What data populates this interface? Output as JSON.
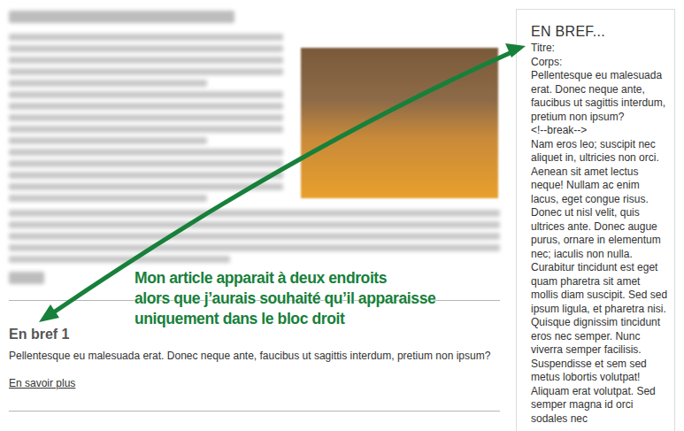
{
  "annotation": {
    "lines": [
      "Mon article apparait à deux endroits",
      "alors que j’aurais souhaité qu’il apparaisse",
      "uniquement dans le bloc droit"
    ]
  },
  "main": {
    "teaser": {
      "title": "En bref 1",
      "summary": "Pellentesque eu malesuada erat. Donec neque ante, faucibus ut sagittis interdum, pretium non ipsum?",
      "link": "En savoir plus"
    }
  },
  "sidebar": {
    "heading": "EN BREF...",
    "lines": [
      "Titre:",
      "Corps:",
      "Pellentesque eu malesuada erat. Donec neque ante, faucibus ut sagittis interdum, pretium non ipsum?",
      "<!--break-->",
      "Nam eros leo; suscipit nec aliquet in, ultricies non orci. Aenean sit amet lectus neque! Nullam ac enim lacus, eget congue risus. Donec ut nisl velit, quis ultrices ante. Donec augue purus, ornare in elementum nec; iaculis non nulla. Curabitur tincidunt est eget quam pharetra sit amet mollis diam suscipit. Sed sed ipsum ligula, et pharetra nisi. Quisque dignissim tincidunt eros nec semper. Nunc viverra semper facilisis. Suspendisse et sem sed metus lobortis volutpat! Aliquam erat volutpat. Sed semper magna id orci sodales nec"
    ]
  }
}
